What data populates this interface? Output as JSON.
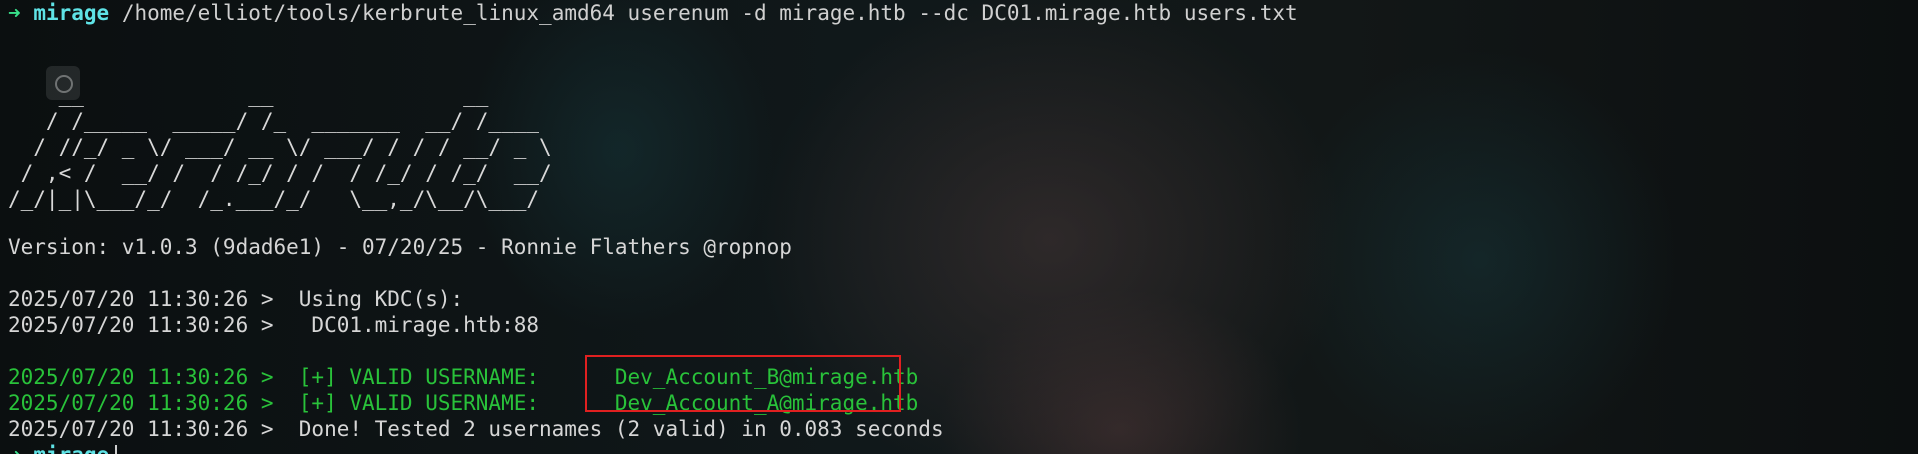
{
  "command_line": {
    "arrow": "➜",
    "dir": "mirage",
    "command": "/home/elliot/tools/kerbrute_linux_amd64 userenum -d mirage.htb --dc DC01.mirage.htb users.txt"
  },
  "banner": {
    "ascii_art": "    __             __               __     \n   / /_____  _____/ /_  _______  __/ /____ \n  / //_/ _ \\/ ___/ __ \\/ ___/ / / / __/ _ \\\n / ,< /  __/ /  / /_/ / /  / /_/ / /_/  __/\n/_/|_|\\___/_/  /_.___/_/   \\__,_/\\__/\\___/ "
  },
  "output": {
    "version": "Version: v1.0.3 (9dad6e1) - 07/20/25 - Ronnie Flathers @ropnop",
    "kdc_header": "2025/07/20 11:30:26 >  Using KDC(s):",
    "kdc_entry": "2025/07/20 11:30:26 >   DC01.mirage.htb:88",
    "valid_1_prefix": "2025/07/20 11:30:26 >  [+] VALID USERNAME:",
    "valid_1_user": "Dev_Account_B@mirage.htb",
    "valid_2_prefix": "2025/07/20 11:30:26 >  [+] VALID USERNAME:",
    "valid_2_user": "Dev_Account_A@mirage.htb",
    "done": "2025/07/20 11:30:26 >  Done! Tested 2 usernames (2 valid) in 0.083 seconds"
  },
  "next_prompt": {
    "arrow": "➜",
    "dir": "mirage"
  },
  "colors": {
    "prompt_arrow": "#38e08a",
    "prompt_dir": "#5fe3e6",
    "success_green": "#29c23a",
    "highlight_red": "#e02020"
  }
}
